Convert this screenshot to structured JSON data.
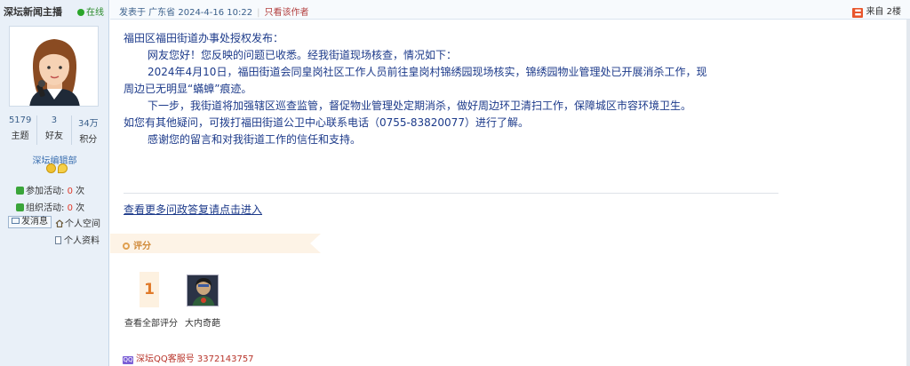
{
  "user": {
    "name": "深坛新闻主播",
    "status": "在线",
    "stats": [
      {
        "value": "5179",
        "label": "主题"
      },
      {
        "value": "3",
        "label": "好友"
      },
      {
        "value": "34万",
        "label": "积分"
      }
    ],
    "group": "深坛编辑部",
    "activity": {
      "join_label": "参加活动: ",
      "join_count": "0",
      "join_unit": " 次",
      "organize_label": "组织活动: ",
      "organize_count": "0",
      "organize_unit": " 次"
    },
    "actions": {
      "message": "发消息",
      "space": "个人空间",
      "profile": "个人资料"
    }
  },
  "post": {
    "posted": "发表于 广东省 2024-4-16 10:22",
    "author_only": "只看该作者",
    "source": "来自",
    "floor": "2楼",
    "paragraphs": [
      "福田区福田街道办事处授权发布：",
      "网友您好！您反映的问题已收悉。经我街道现场核查，情况如下：",
      "2024年4月10日，福田街道会同皇岗社区工作人员前往皇岗村锦绣园现场核实，锦绣园物业管理处已开展消杀工作，现",
      "周边已无明显“蟎蟑”痕迹。",
      "下一步，我街道将加强辖区巡查监管，督促物业管理处定期消杀，做好周边环卫清扫工作，保障城区市容环境卫生。",
      "如您有其他疑问，可拨打福田街道公卫中心联系电话（0755-83820077）进行了解。",
      "感谢您的留言和对我街道工作的信任和支持。"
    ],
    "more_link": "查看更多问政答复请点击进入",
    "rating": {
      "label": "评分",
      "count": "1",
      "view_all": "查看全部评分",
      "rater": "大内奇葩"
    },
    "qq": "深坛QQ客服号 3372143757"
  }
}
